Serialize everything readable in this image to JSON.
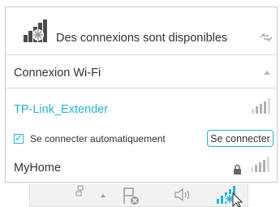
{
  "header": {
    "title": "Des connexions sont disponibles",
    "network_icon": "network-available-icon",
    "refresh_icon": "refresh-icon"
  },
  "wifi_section": {
    "label": "Connexion Wi-Fi",
    "toggle_icon": "chevron-up-icon"
  },
  "networks": [
    {
      "ssid": "TP-Link_Extender",
      "selected": true,
      "signal_bars": 3,
      "auto_connect_label": "Se connecter automatiquement",
      "auto_connect_checked": true,
      "connect_label": "Se connecter"
    },
    {
      "ssid": "MyHome",
      "secured": true,
      "signal_bars": 3
    }
  ],
  "taskbar": {
    "icons": [
      "network-icon",
      "show-hidden-icons-chevron",
      "flag-icon",
      "volume-icon",
      "wifi-available-icon"
    ]
  },
  "colors": {
    "accent": "#29b3d6",
    "text": "#333333",
    "muted": "#a8a8a8"
  }
}
